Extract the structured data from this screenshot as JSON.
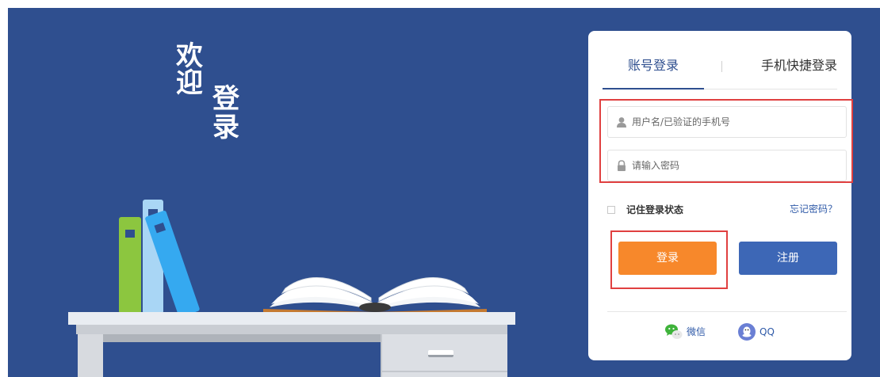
{
  "welcome": {
    "chars": [
      "欢",
      "迎",
      "登",
      "录"
    ]
  },
  "tabs": {
    "account_label": "账号登录",
    "phone_label": "手机快捷登录"
  },
  "form": {
    "username_placeholder": "用户名/已验证的手机号",
    "password_placeholder": "请输入密码",
    "remember_label": "记住登录状态",
    "forgot_label": "忘记密码？"
  },
  "buttons": {
    "login_label": "登录",
    "register_label": "注册"
  },
  "social": {
    "wechat_label": "微信",
    "qq_label": "QQ"
  },
  "colors": {
    "background": "#2f4f8f",
    "accent_blue": "#3d67b6",
    "login_orange": "#f7882b",
    "highlight_red": "#e04040",
    "link_blue": "#2f5aa8"
  },
  "icons": {
    "username": "user-icon",
    "password": "lock-icon",
    "wechat": "wechat-icon",
    "qq": "qq-icon"
  }
}
